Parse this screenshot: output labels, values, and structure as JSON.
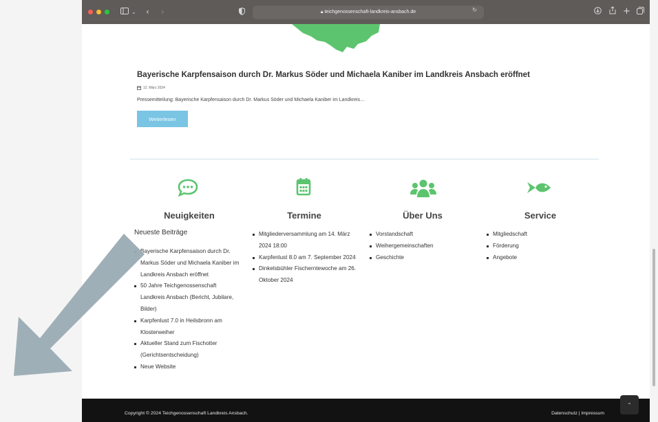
{
  "browser": {
    "url": "teichgenossenschaft-landkreis-ansbach.de",
    "traffic_colors": [
      "#ff5f57",
      "#febc2e",
      "#28c840"
    ]
  },
  "post": {
    "title": "Bayerische Karpfensaison durch Dr. Markus Söder und Michaela Kaniber im Landkreis Ansbach eröffnet",
    "date": "12. März 2024",
    "excerpt": "Pressemitteilung: Bayerische Karpfensaison durch Dr. Markus Söder und Michaela Kaniber im Landkreis…",
    "read_more": "Weiterlesen"
  },
  "columns": {
    "news": {
      "title": "Neuigkeiten",
      "subtitle": "Neueste Beiträge",
      "items": [
        "Bayerische Karpfensaison durch Dr. Markus Söder und Michaela Kaniber im Landkreis Ansbach eröffnet",
        "50 Jahre Teichgenossenschaft Landkreis Ansbach (Bericht, Jubilare, Bilder)",
        "Karpfenlust 7.0 in Heilsbronn am Klosterweiher",
        "Aktueller Stand zum Fischotter (Gerichtsentscheidung)",
        "Neue Website"
      ]
    },
    "events": {
      "title": "Termine",
      "items": [
        "Mitgliederversammlung am 14. März 2024 18:00",
        "Karpfenlust 8.0 am 7. September 2024",
        "Dinkelsbühler Fischerntewoche am 26. Oktober 2024"
      ]
    },
    "about": {
      "title": "Über Uns",
      "items": [
        "Vorstandschaft",
        "Weihergemeinschaften",
        "Geschichte"
      ]
    },
    "service": {
      "title": "Service",
      "items": [
        "Mitgliedschaft",
        "Förderung",
        "Angebote"
      ]
    }
  },
  "footer": {
    "copyright": "Copyright © 2024 Teichgenossenschaft Landkreis Ansbach.",
    "links": "Datenschutz | Impressum"
  },
  "icons": {
    "news": "speech-bubble-icon",
    "events": "calendar-icon",
    "about": "users-icon",
    "service": "fish-icon",
    "back_to_top": "chevron-up-icon"
  },
  "colors": {
    "accent_green": "#5cc46e",
    "button_blue": "#7ac4e4",
    "footer_bg": "#121212",
    "annotation_arrow": "#9aabb3"
  }
}
